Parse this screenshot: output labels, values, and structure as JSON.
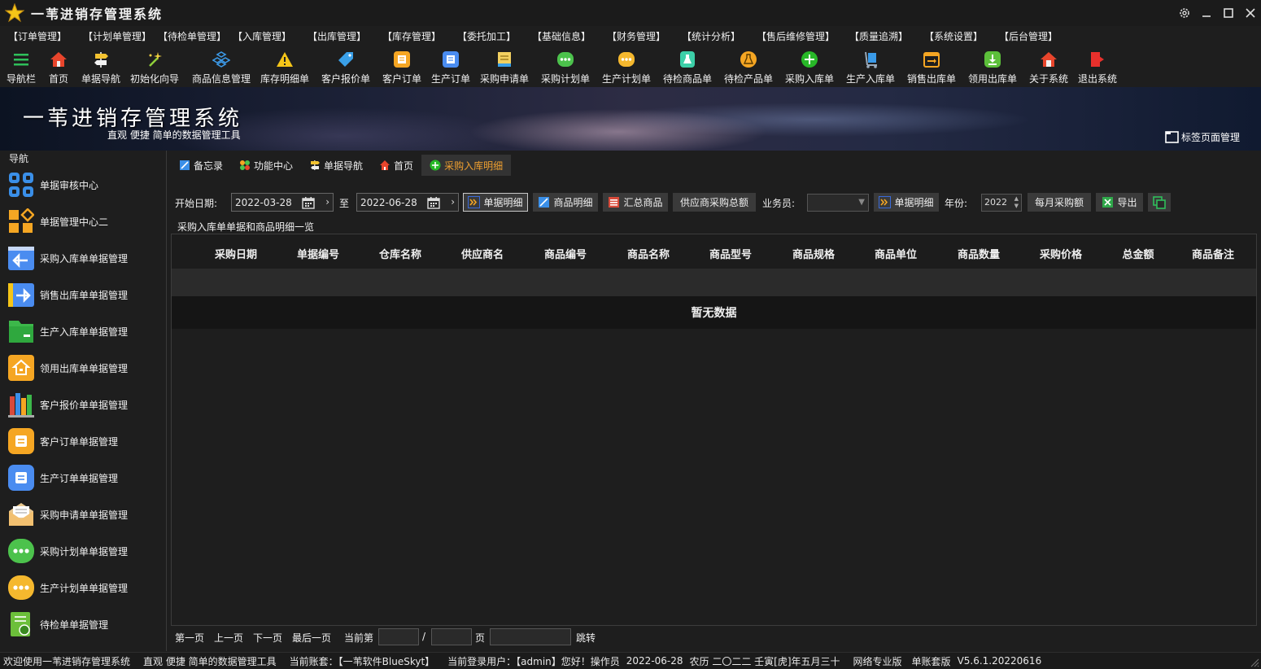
{
  "app": {
    "title": "一苇进销存管理系统"
  },
  "menu": [
    "【订单管理】",
    "【计划单管理】",
    "【待检单管理】",
    "【入库管理】",
    "【出库管理】",
    "【库存管理】",
    "【委托加工】",
    "【基础信息】",
    "【财务管理】",
    "【统计分析】",
    "【售后维修管理】",
    "【质量追溯】",
    "【系统设置】",
    "【后台管理】"
  ],
  "toolbar": [
    {
      "label": "导航栏",
      "icon": "menu-bars-icon",
      "color": "#2fbf5a"
    },
    {
      "label": "首页",
      "icon": "home-icon",
      "color": "#e8452c"
    },
    {
      "label": "单据导航",
      "icon": "signpost-icon",
      "color": "#f2c230"
    },
    {
      "label": "初始化向导",
      "icon": "magic-wand-icon",
      "color": "#8fcf3a"
    },
    {
      "label": "商品信息管理",
      "icon": "cubes-icon",
      "color": "#3c9ae8"
    },
    {
      "label": "库存明细单",
      "icon": "warning-icon",
      "color": "#f5c518"
    },
    {
      "label": "客户报价单",
      "icon": "price-tag-icon",
      "color": "#3aa0e8"
    },
    {
      "label": "客户订单",
      "icon": "order-doc-icon",
      "color": "#f5a623"
    },
    {
      "label": "生产订单",
      "icon": "production-doc-icon",
      "color": "#4a8cf0"
    },
    {
      "label": "采购申请单",
      "icon": "request-doc-icon",
      "color": "#f2d060"
    },
    {
      "label": "采购计划单",
      "icon": "chat-dots-icon",
      "color": "#4cc24c"
    },
    {
      "label": "生产计划单",
      "icon": "chat-dots-icon",
      "color": "#f5b82e"
    },
    {
      "label": "待检商品单",
      "icon": "flask-icon",
      "color": "#3ccfa8"
    },
    {
      "label": "待检产品单",
      "icon": "beaker-icon",
      "color": "#f5a623"
    },
    {
      "label": "采购入库单",
      "icon": "plus-circle-icon",
      "color": "#28b828"
    },
    {
      "label": "生产入库单",
      "icon": "hand-truck-icon",
      "color": "#3a9ae8"
    },
    {
      "label": "销售出库单",
      "icon": "export-box-icon",
      "color": "#f5a623"
    },
    {
      "label": "领用出库单",
      "icon": "download-box-icon",
      "color": "#5cbf3a"
    },
    {
      "label": "关于系统",
      "icon": "house-info-icon",
      "color": "#e8452c"
    },
    {
      "label": "退出系统",
      "icon": "exit-door-icon",
      "color": "#e8302c"
    }
  ],
  "banner": {
    "title": "一苇进销存管理系统",
    "subtitle": "直观 便捷 简单的数据管理工具",
    "tab_manage": "标签页面管理"
  },
  "sidebar": {
    "title": "导航",
    "items": [
      {
        "label": "单据审核中心",
        "icon": "grid-apps-icon",
        "color": "#3a8fe8"
      },
      {
        "label": "单据管理中心二",
        "icon": "grid-diamond-icon",
        "color": "#f5a623"
      },
      {
        "label": "采购入库单单据管理",
        "icon": "arrow-left-icon",
        "color": "#4a8cf0"
      },
      {
        "label": "销售出库单单据管理",
        "icon": "arrow-right-icon",
        "color": "#4a8cf0"
      },
      {
        "label": "生产入库单单据管理",
        "icon": "folder-icon",
        "color": "#3cb84a"
      },
      {
        "label": "领用出库单单据管理",
        "icon": "house-doc-icon",
        "color": "#f5a623"
      },
      {
        "label": "客户报价单单据管理",
        "icon": "books-icon",
        "color": "#d84a3a"
      },
      {
        "label": "客户订单单据管理",
        "icon": "order-doc-icon",
        "color": "#f5a623"
      },
      {
        "label": "生产订单单据管理",
        "icon": "production-doc-icon",
        "color": "#4a8cf0"
      },
      {
        "label": "采购申请单单据管理",
        "icon": "envelope-icon",
        "color": "#f2c070"
      },
      {
        "label": "采购计划单单据管理",
        "icon": "chat-dots-icon",
        "color": "#4cc24c"
      },
      {
        "label": "生产计划单单据管理",
        "icon": "chat-dots-icon",
        "color": "#f5b82e"
      },
      {
        "label": "待检单单据管理",
        "icon": "check-doc-icon",
        "color": "#6cbf3a"
      }
    ]
  },
  "tabs": [
    {
      "label": "备忘录",
      "icon": "memo-icon"
    },
    {
      "label": "功能中心",
      "icon": "function-icon"
    },
    {
      "label": "单据导航",
      "icon": "signpost-icon"
    },
    {
      "label": "首页",
      "icon": "home-icon"
    },
    {
      "label": "采购入库明细",
      "icon": "plus-circle-icon",
      "active": true
    }
  ],
  "filter": {
    "start_label": "开始日期:",
    "start_date": "2022-03-28",
    "to_label": "至",
    "end_date": "2022-06-28",
    "btn_doc_detail": "单据明细",
    "btn_goods_detail": "商品明细",
    "btn_summary": "汇总商品",
    "btn_supplier_total": "供应商采购总额",
    "salesman_label": "业务员:",
    "salesman_value": "",
    "btn_doc_detail2": "单据明细",
    "year_label": "年份:",
    "year_value": "2022",
    "btn_monthly": "每月采购额",
    "btn_export": "导出"
  },
  "grid": {
    "caption": "采购入库单单据和商品明细一览",
    "columns": [
      "采购日期",
      "单据编号",
      "仓库名称",
      "供应商名",
      "商品编号",
      "商品名称",
      "商品型号",
      "商品规格",
      "商品单位",
      "商品数量",
      "采购价格",
      "总金额",
      "商品备注"
    ],
    "empty_text": "暂无数据"
  },
  "pager": {
    "first": "第一页",
    "prev": "上一页",
    "next": "下一页",
    "last": "最后一页",
    "current_label": "当前第",
    "slash": "/",
    "page_label": "页",
    "jump": "跳转"
  },
  "status": {
    "welcome": "欢迎使用一苇进销存管理系统",
    "slogan": "直观 便捷 简单的数据管理工具",
    "account": "当前账套：【一苇软件BlueSkyt】",
    "user": "当前登录用户：【admin】您好！操作员",
    "date": "2022-06-28",
    "lunar": "农历 二〇二二 壬寅[虎]年五月三十",
    "edition": "网络专业版",
    "book_edition": "单账套版",
    "version": "V5.6.1.20220616"
  }
}
